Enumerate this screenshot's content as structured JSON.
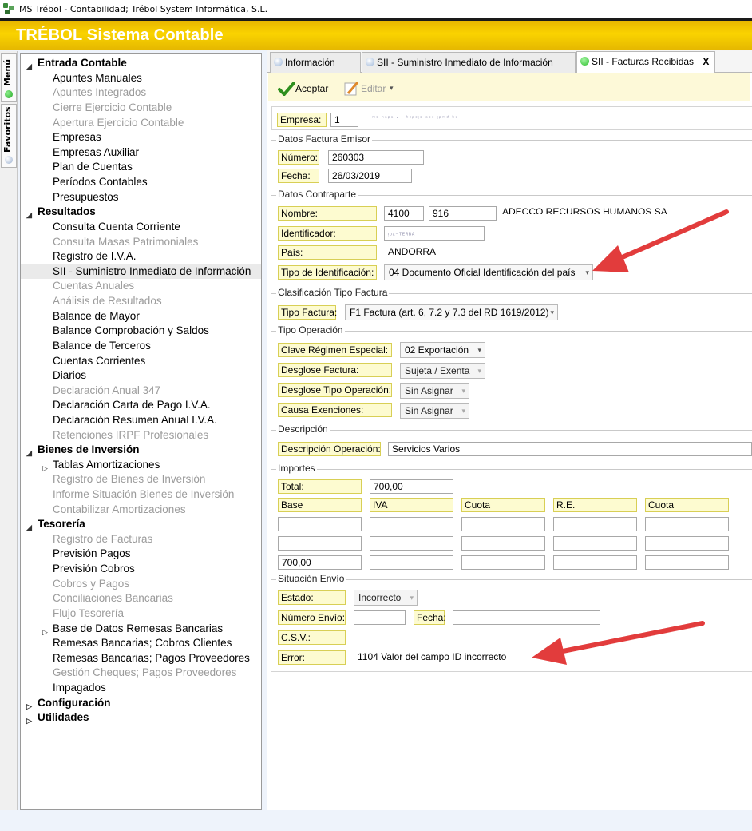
{
  "window": {
    "title": "MS Trébol - Contabilidad; Trébol System Informática, S.L."
  },
  "banner": {
    "title": "TRÉBOL Sistema Contable"
  },
  "side_tabs": {
    "menu": "Menú",
    "favoritos": "Favoritos"
  },
  "tree": {
    "entrada": {
      "label": "Entrada Contable",
      "items": [
        "Apuntes Manuales",
        "Apuntes Integrados",
        "Cierre Ejercicio Contable",
        "Apertura Ejercicio Contable",
        "Empresas",
        "Empresas Auxiliar",
        "Plan de Cuentas",
        "Períodos Contables",
        "Presupuestos"
      ]
    },
    "resultados": {
      "label": "Resultados",
      "items": [
        "Consulta Cuenta Corriente",
        "Consulta Masas Patrimoniales",
        "Registro de I.V.A.",
        "SII - Suministro Inmediato de Información",
        "Cuentas Anuales",
        "Análisis de Resultados",
        "Balance de Mayor",
        "Balance Comprobación y Saldos",
        "Balance de Terceros",
        "Cuentas Corrientes",
        "Diarios",
        "Declaración Anual 347",
        "Declaración Carta de Pago I.V.A.",
        "Declaración Resumen Anual I.V.A.",
        "Retenciones IRPF Profesionales"
      ]
    },
    "bienes": {
      "label": "Bienes de Inversión",
      "items": [
        "Tablas Amortizaciones",
        "Registro de Bienes de Inversión",
        "Informe Situación Bienes de Inversión",
        "Contabilizar Amortizaciones"
      ]
    },
    "tesoreria": {
      "label": "Tesorería",
      "items": [
        "Registro de Facturas",
        "Previsión Pagos",
        "Previsión Cobros",
        "Cobros y Pagos",
        "Conciliaciones Bancarias",
        "Flujo Tesorería",
        "Base de Datos Remesas Bancarias",
        "Remesas Bancarias; Cobros Clientes",
        "Remesas Bancarias; Pagos Proveedores",
        "Gestión Cheques; Pagos Proveedores",
        "Impagados"
      ]
    },
    "configuracion": {
      "label": "Configuración"
    },
    "utilidades": {
      "label": "Utilidades"
    }
  },
  "tabs": {
    "informacion": "Información",
    "sii": "SII - Suministro Inmediato de Información",
    "facturas": "SII - Facturas Recibidas",
    "close": "X"
  },
  "toolbar": {
    "aceptar": "Aceptar",
    "editar": "Editar"
  },
  "form": {
    "empresa": {
      "label": "Empresa:",
      "value": "1"
    },
    "emisor": {
      "title": "Datos Factura Emisor",
      "numero_label": "Número:",
      "numero": "260303",
      "fecha_label": "Fecha:",
      "fecha": "26/03/2019"
    },
    "contraparte": {
      "title": "Datos Contraparte",
      "nombre_label": "Nombre:",
      "nombre_cuenta": "4100",
      "nombre_sub": "916",
      "nombre_text": "ADECCO RECURSOS HUMANOS SA",
      "identificador_label": "Identificador:",
      "pais_label": "País:",
      "pais": "ANDORRA",
      "tipo_id_label": "Tipo de Identificación:",
      "tipo_id": "04 Documento Oficial Identificación del país"
    },
    "clasificacion": {
      "title": "Clasificación Tipo Factura",
      "tipo_label": "Tipo Factura:",
      "tipo": "F1 Factura (art. 6, 7.2 y 7.3 del RD 1619/2012)"
    },
    "operacion": {
      "title": "Tipo Operación",
      "clave_label": "Clave Régimen Especial:",
      "clave": "02 Exportación",
      "desglose_label": "Desglose Factura:",
      "desglose": "Sujeta / Exenta",
      "desglose_tipo_label": "Desglose Tipo Operación:",
      "desglose_tipo": "Sin Asignar",
      "causa_label": "Causa Exenciones:",
      "causa": "Sin Asignar"
    },
    "descripcion": {
      "title": "Descripción",
      "label": "Descripción Operación:",
      "value": "Servicios Varios"
    },
    "importes": {
      "title": "Importes",
      "total_label": "Total:",
      "total": "700,00",
      "headers": [
        "Base",
        "IVA",
        "Cuota",
        "R.E.",
        "Cuota"
      ],
      "rows": [
        [
          "",
          "",
          "",
          "",
          ""
        ],
        [
          "",
          "",
          "",
          "",
          ""
        ],
        [
          "700,00",
          "",
          "",
          "",
          ""
        ]
      ]
    },
    "envio": {
      "title": "Situación Envío",
      "estado_label": "Estado:",
      "estado": "Incorrecto",
      "numero_label": "Número Envío:",
      "fecha_label": "Fecha:",
      "csv_label": "C.S.V.:",
      "error_label": "Error:",
      "error": "1104 Valor del campo ID incorrecto"
    }
  },
  "colors": {
    "banner": "#fad300",
    "label_bg": "#fdfbd0",
    "label_border": "#d8cf55",
    "arrow": "#e23c3c",
    "status_green": "#2fbf2f"
  }
}
